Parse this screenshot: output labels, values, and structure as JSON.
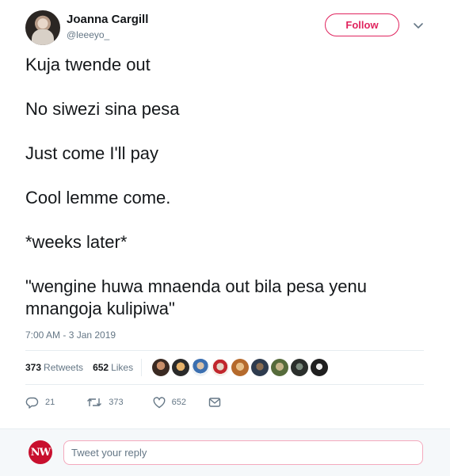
{
  "author": {
    "name": "Joanna Cargill",
    "handle": "@leeeyo_"
  },
  "header": {
    "follow_label": "Follow"
  },
  "tweet": {
    "lines": [
      "Kuja twende out",
      "No siwezi sina pesa",
      "Just come I'll pay",
      "Cool lemme come.",
      "*weeks later*",
      "\"wengine huwa mnaenda out bila pesa yenu mnangoja kulipiwa\""
    ],
    "timestamp": "7:00 AM - 3 Jan 2019"
  },
  "stats": {
    "retweets_count": "373",
    "retweets_label": "Retweets",
    "likes_count": "652",
    "likes_label": "Likes"
  },
  "actions": {
    "replies": "21",
    "retweets": "373",
    "likes": "652"
  },
  "reply": {
    "avatar_text": "NW",
    "placeholder": "Tweet your reply"
  },
  "colors": {
    "accent": "#e0245e",
    "muted": "#657786",
    "divider": "#e6ecf0"
  },
  "icons": [
    "chevron-down-icon",
    "reply-icon",
    "retweet-icon",
    "like-icon",
    "message-icon"
  ]
}
